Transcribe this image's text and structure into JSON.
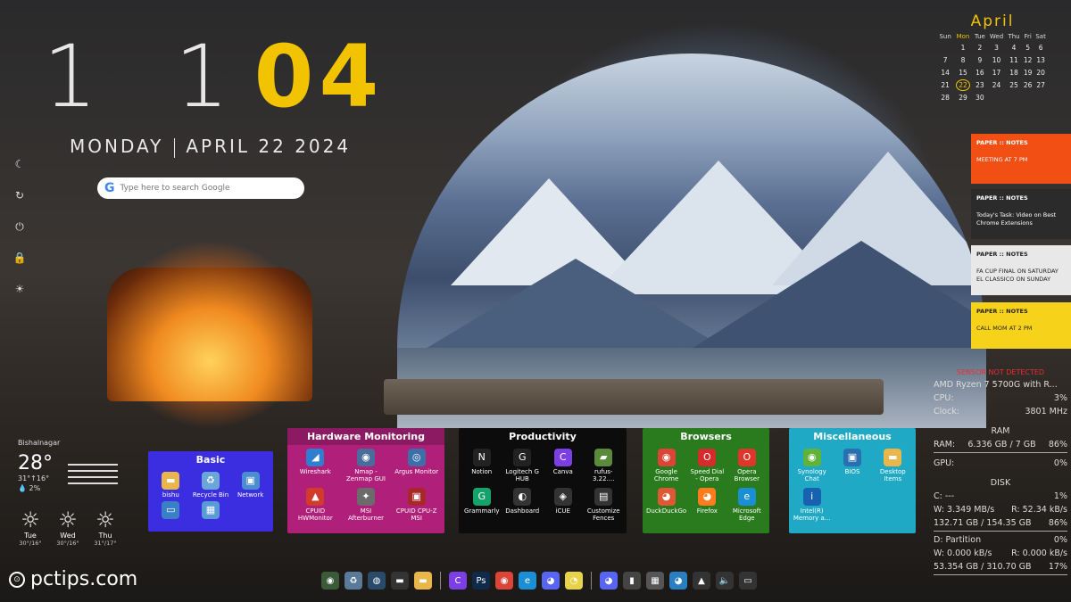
{
  "clock": {
    "hours": "1 1",
    "minutes": "04",
    "day": "MONDAY",
    "date": "APRIL 22 2024"
  },
  "search": {
    "g": "G",
    "placeholder": "Type here to search Google"
  },
  "side_icons": [
    "☾",
    "↻",
    "⏻",
    "🔒",
    "☀"
  ],
  "calendar": {
    "month": "April",
    "weekdays": [
      "Sun",
      "Mon",
      "Tue",
      "Wed",
      "Thu",
      "Fri",
      "Sat"
    ],
    "weeks": [
      [
        "",
        "1",
        "2",
        "3",
        "4",
        "5",
        "6"
      ],
      [
        "7",
        "8",
        "9",
        "10",
        "11",
        "12",
        "13"
      ],
      [
        "14",
        "15",
        "16",
        "17",
        "18",
        "19",
        "20"
      ],
      [
        "21",
        "22",
        "23",
        "24",
        "25",
        "26",
        "27"
      ],
      [
        "28",
        "29",
        "30",
        "",
        "",
        "",
        ""
      ]
    ],
    "today": "22"
  },
  "notes": [
    {
      "title": "PAPER :: NOTES",
      "text": "MEETING AT 7 PM",
      "bg": "#f24f14",
      "color": "#ffffff"
    },
    {
      "title": "PAPER :: NOTES",
      "text": "Today's Task: Video on Best Chrome Extensions",
      "bg": "#2b2b2b",
      "color": "#ffffff"
    },
    {
      "title": "PAPER :: NOTES",
      "text": "FA CUP FINAL ON SATURDAY EL CLASSICO ON SUNDAY",
      "bg": "#e8e8e8",
      "color": "#222222"
    },
    {
      "title": "PAPER :: NOTES",
      "text": "CALL MOM AT 2 PM",
      "bg": "#f7d21a",
      "color": "#222222"
    }
  ],
  "sysmon": {
    "warning": "SENSOR NOT DETECTED",
    "cpu_name": "AMD Ryzen 7 5700G with R...",
    "cpu_label": "CPU:",
    "cpu_value": "3%",
    "clock_label": "Clock:",
    "clock_value": "3801 MHz",
    "ram_header": "RAM",
    "ram_label": "RAM:",
    "ram_value": "6.336 GB / 7 GB",
    "ram_pct": "86%",
    "gpu_label": "GPU:",
    "gpu_value": "0%",
    "disk_header": "DISK",
    "c_label": "C: ---",
    "c_pct": "1%",
    "c_w": "W: 3.349 MB/s",
    "c_r": "R: 52.34 kB/s",
    "c_space": "132.71 GB / 154.35 GB",
    "c_space_pct": "86%",
    "d_label": "D: Partition",
    "d_pct": "0%",
    "d_w": "W: 0.000 kB/s",
    "d_r": "R: 0.000 kB/s",
    "d_space": "53.354 GB / 310.70 GB",
    "d_space_pct": "17%"
  },
  "weather": {
    "location": "Bishalnagar",
    "temp": "28°",
    "hilo": "31°↑16°",
    "precip": "💧 2%",
    "days": [
      {
        "name": "Tue",
        "temps": "30°/16°"
      },
      {
        "name": "Wed",
        "temps": "30°/16°"
      },
      {
        "name": "Thu",
        "temps": "31°/17°"
      }
    ]
  },
  "fences": {
    "basic": {
      "title": "Basic",
      "items": [
        {
          "label": "bishu",
          "icon": "▬",
          "color": "#e8b64a"
        },
        {
          "label": "Recycle Bin",
          "icon": "♻",
          "color": "#6aa6d8"
        },
        {
          "label": "Network",
          "icon": "▣",
          "color": "#4b8ed0"
        },
        {
          "label": "",
          "icon": "▭",
          "color": "#3b7fc6"
        },
        {
          "label": "",
          "icon": "▦",
          "color": "#5a9ad6"
        }
      ]
    },
    "hardware": {
      "title": "Hardware Monitoring",
      "items": [
        {
          "label": "Wireshark",
          "icon": "◢",
          "color": "#2f7fd0"
        },
        {
          "label": "Nmap - Zenmap GUI",
          "icon": "◉",
          "color": "#4a6c9a"
        },
        {
          "label": "Argus Monitor",
          "icon": "◎",
          "color": "#3c6fa8"
        },
        {
          "label": "CPUID HWMonitor",
          "icon": "▲",
          "color": "#d23a2a"
        },
        {
          "label": "MSI Afterburner",
          "icon": "✦",
          "color": "#6b6b6b"
        },
        {
          "label": "CPUID CPU-Z MSI",
          "icon": "▣",
          "color": "#a8282a"
        }
      ]
    },
    "productivity": {
      "title": "Productivity",
      "items": [
        {
          "label": "Notion",
          "icon": "N",
          "color": "#222222"
        },
        {
          "label": "Logitech G HUB",
          "icon": "G",
          "color": "#222222"
        },
        {
          "label": "Canva",
          "icon": "C",
          "color": "#7b3fe4"
        },
        {
          "label": "rufus-3.22....",
          "icon": "▰",
          "color": "#5a8a3a"
        },
        {
          "label": "Grammarly",
          "icon": "G",
          "color": "#15a36c"
        },
        {
          "label": "Dashboard",
          "icon": "◐",
          "color": "#333333"
        },
        {
          "label": "iCUE",
          "icon": "◈",
          "color": "#333333"
        },
        {
          "label": "Customize Fences",
          "icon": "▤",
          "color": "#333333"
        }
      ]
    },
    "browsers": {
      "title": "Browsers",
      "items": [
        {
          "label": "Google Chrome",
          "icon": "◉",
          "color": "#db4437"
        },
        {
          "label": "Speed Dial - Opera",
          "icon": "O",
          "color": "#d62b2b"
        },
        {
          "label": "Opera Browser",
          "icon": "O",
          "color": "#e0352b"
        },
        {
          "label": "DuckDuckGo",
          "icon": "◕",
          "color": "#de5833"
        },
        {
          "label": "Firefox",
          "icon": "◕",
          "color": "#ff7b1c"
        },
        {
          "label": "Microsoft Edge",
          "icon": "e",
          "color": "#1a8fd6"
        }
      ]
    },
    "misc": {
      "title": "Miscellaneous",
      "items": [
        {
          "label": "Synology Chat",
          "icon": "◉",
          "color": "#5fb23a"
        },
        {
          "label": "BIOS",
          "icon": "▣",
          "color": "#2a6fb0"
        },
        {
          "label": "Desktop Items",
          "icon": "▬",
          "color": "#e8b64a"
        },
        {
          "label": "Intel(R) Memory a...",
          "icon": "i",
          "color": "#1860b0"
        }
      ]
    }
  },
  "taskbar": {
    "left": [
      {
        "name": "app-1",
        "icon": "◉",
        "color": "#3a5a3a"
      },
      {
        "name": "app-2",
        "icon": "♻",
        "color": "#5a7a9a"
      },
      {
        "name": "app-3",
        "icon": "◍",
        "color": "#2a4a6a"
      },
      {
        "name": "app-4",
        "icon": "▬",
        "color": "#333333"
      },
      {
        "name": "file-explorer",
        "icon": "▬",
        "color": "#e8b64a"
      }
    ],
    "mid": [
      {
        "name": "canva",
        "icon": "C",
        "color": "#7b3fe4"
      },
      {
        "name": "photoshop",
        "icon": "Ps",
        "color": "#0f2a4a"
      },
      {
        "name": "chrome",
        "icon": "◉",
        "color": "#db4437"
      },
      {
        "name": "edge",
        "icon": "e",
        "color": "#1a8fd6"
      },
      {
        "name": "discord",
        "icon": "◕",
        "color": "#5865f2"
      },
      {
        "name": "chat",
        "icon": "◔",
        "color": "#e8d24a"
      }
    ],
    "right": [
      {
        "name": "discord-tray",
        "icon": "◕",
        "color": "#5865f2"
      },
      {
        "name": "tray-1",
        "icon": "▮",
        "color": "#444444"
      },
      {
        "name": "tray-2",
        "icon": "▦",
        "color": "#555555"
      },
      {
        "name": "tray-3",
        "icon": "◕",
        "color": "#2a7fc0"
      },
      {
        "name": "tray-4",
        "icon": "▲",
        "color": "#333333"
      },
      {
        "name": "volume",
        "icon": "🔈",
        "color": "#333333"
      },
      {
        "name": "network",
        "icon": "▭",
        "color": "#333333"
      }
    ]
  },
  "watermark": {
    "pin": "⊙",
    "text": "pctips.com"
  }
}
